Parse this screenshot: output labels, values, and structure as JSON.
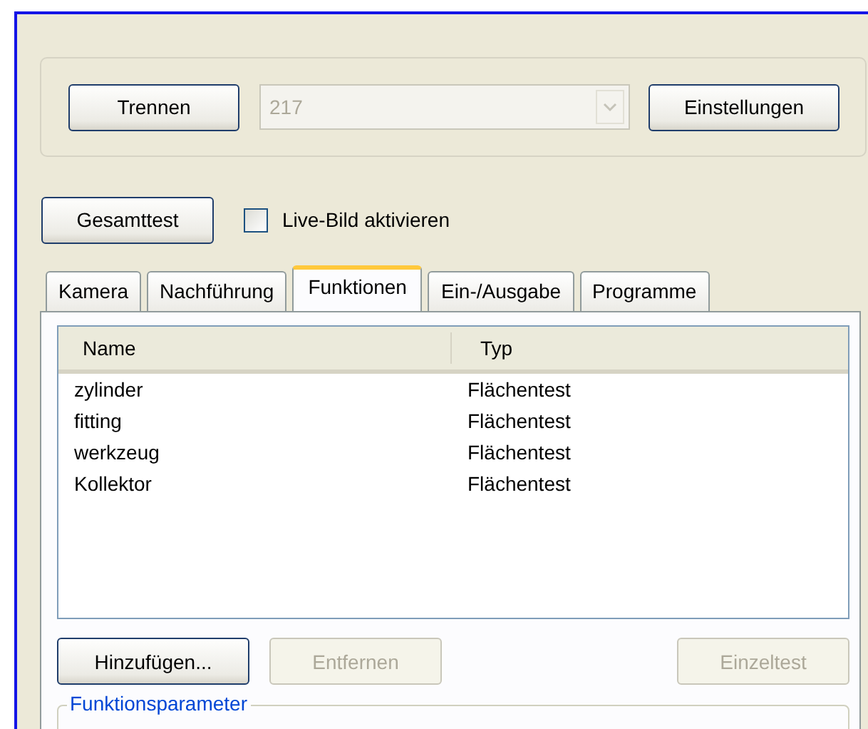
{
  "connection": {
    "disconnect_button": "Trennen",
    "device": {
      "value": "217",
      "disabled": true
    },
    "settings_button": "Einstellungen"
  },
  "full_test_button": "Gesamttest",
  "live_image": {
    "label": "Live-Bild aktivieren",
    "checked": false
  },
  "tabs": [
    {
      "label": "Kamera",
      "selected": false
    },
    {
      "label": "Nachführung",
      "selected": false
    },
    {
      "label": "Funktionen",
      "selected": true
    },
    {
      "label": "Ein-/Ausgabe",
      "selected": false
    },
    {
      "label": "Programme",
      "selected": false
    }
  ],
  "table": {
    "columns": [
      "Name",
      "Typ"
    ],
    "rows": [
      [
        "zylinder",
        "Flächentest"
      ],
      [
        "fitting",
        "Flächentest"
      ],
      [
        "werkzeug",
        "Flächentest"
      ],
      [
        "Kollektor",
        "Flächentest"
      ]
    ]
  },
  "buttons": [
    {
      "label": "Hinzufügen...",
      "disabled": false
    },
    {
      "label": "Entfernen",
      "disabled": true
    },
    {
      "label": "Einzeltest",
      "disabled": true
    }
  ],
  "parameters_group": {
    "title": "Funktionsparameter"
  }
}
